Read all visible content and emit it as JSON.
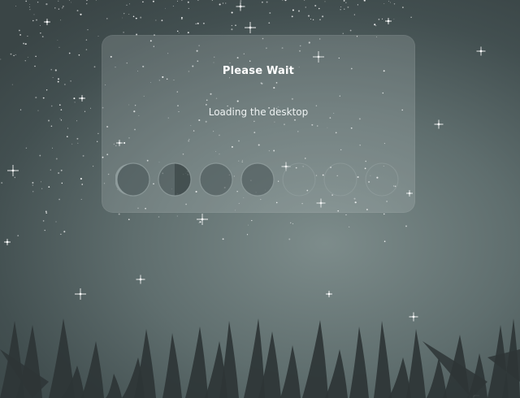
{
  "splash": {
    "title": "Please Wait",
    "subtitle": "Loading the desktop"
  },
  "progress": {
    "total_steps": 7,
    "completed_steps": 4,
    "step_icons": [
      "moon-phase-icon",
      "moon-phase-icon",
      "moon-phase-icon",
      "moon-phase-icon",
      "moon-phase-icon",
      "moon-phase-icon",
      "moon-phase-icon"
    ]
  },
  "colors": {
    "background_center": "#7d8c8b",
    "background_edge": "#3a4546",
    "panel": "#bec8c8",
    "text": "#ffffff",
    "grass": "#2e3536"
  }
}
